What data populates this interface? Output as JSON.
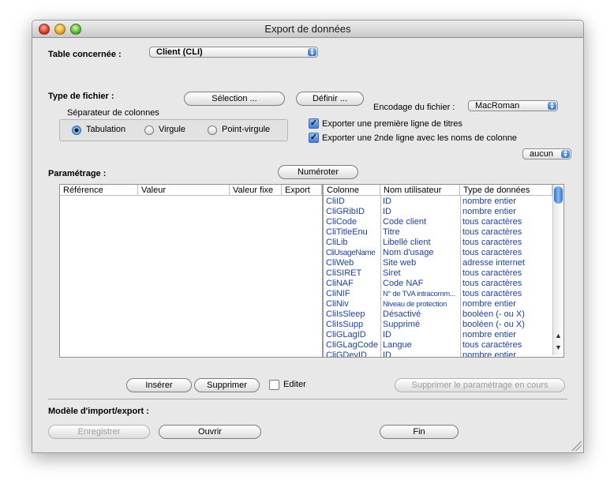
{
  "window": {
    "title": "Export de données"
  },
  "table_section": {
    "label": "Table concernée :",
    "selected": "Client  (CLI)"
  },
  "file_type": {
    "label": "Type de fichier :",
    "selection_button": "Sélection ...",
    "define_button": "Définir ...",
    "encoding_label": "Encodage du fichier :",
    "encoding_value": "MacRoman",
    "separator_label": "Séparateur de colonnes",
    "separators": [
      "Tabulation",
      "Virgule",
      "Point-virgule"
    ],
    "selected_separator": "Tabulation",
    "export_titles": "Exporter une première ligne de titres",
    "export_titles_checked": true,
    "export_colnames": "Exporter une 2nde ligne avec les noms de colonne",
    "export_colnames_checked": true,
    "aucun_value": "aucun"
  },
  "settings": {
    "label": "Paramétrage :",
    "number_button": "Numéroter",
    "left_headers": [
      "Référence",
      "Valeur",
      "Valeur fixe",
      "Export"
    ],
    "right_headers": [
      "Colonne",
      "Nom utilisateur",
      "Type de données"
    ],
    "rows": [
      [
        "CliID",
        "ID",
        "nombre entier"
      ],
      [
        "CliGRibID",
        "ID",
        "nombre entier"
      ],
      [
        "CliCode",
        "Code client",
        "tous caractères"
      ],
      [
        "CliTitleEnu",
        "Titre",
        "tous caractères"
      ],
      [
        "CliLib",
        "Libellé client",
        "tous caractères"
      ],
      [
        "CliUsageName",
        "Nom d'usage",
        "tous caractères"
      ],
      [
        "CliWeb",
        "Site web",
        "adresse internet"
      ],
      [
        "CliSIRET",
        "Siret",
        "tous caractères"
      ],
      [
        "CliNAF",
        "Code NAF",
        "tous caractères"
      ],
      [
        "CliNIF",
        "N° de TVA intracomm...",
        "tous caractères"
      ],
      [
        "CliNiv",
        "Niveau de protection",
        "nombre entier"
      ],
      [
        "CliIsSleep",
        "Désactivé",
        "booléen (- ou X)"
      ],
      [
        "CliIsSupp",
        "Supprimé",
        "booléen (- ou X)"
      ],
      [
        "CliGLagID",
        "ID",
        "nombre entier"
      ],
      [
        "CliGLagCode",
        "Langue",
        "tous caractères"
      ],
      [
        "CliGDevID",
        "ID",
        "nombre entier"
      ]
    ],
    "insert_button": "Insérer",
    "delete_button": "Supprimer",
    "edit_label": "Editer",
    "delete_settings_button": "Supprimer le paramétrage en cours"
  },
  "model": {
    "label": "Modèle d'import/export :",
    "save_button": "Enregistrer",
    "open_button": "Ouvrir",
    "end_button": "Fin"
  },
  "colors": {
    "link_blue": "#1c3fb8",
    "accent": "#3a7fdc"
  }
}
